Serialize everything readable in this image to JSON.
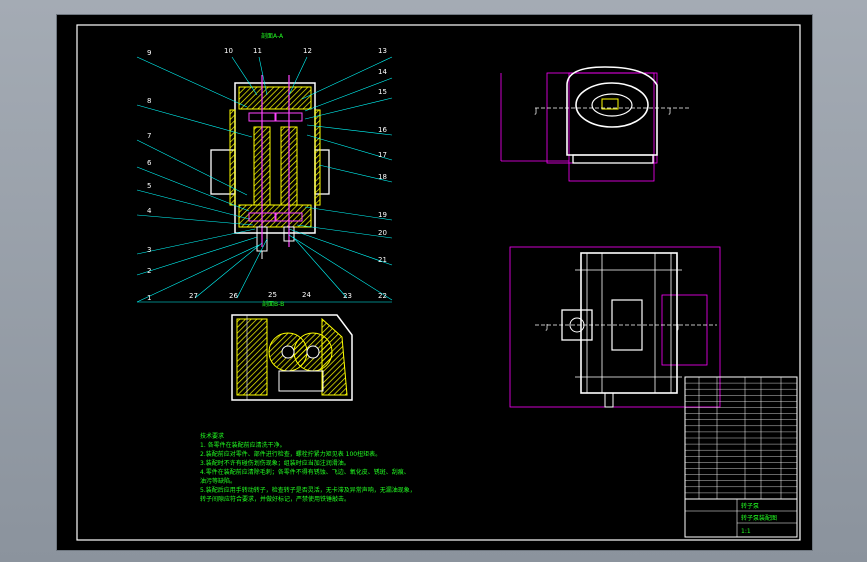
{
  "part_labels_left": [
    "9",
    "8",
    "7",
    "6",
    "5",
    "4",
    "3",
    "2",
    "1"
  ],
  "part_labels_top": [
    "10",
    "11",
    "12",
    "13"
  ],
  "part_labels_right": [
    "14",
    "15",
    "16",
    "17",
    "18",
    "19",
    "20",
    "21",
    "22"
  ],
  "part_labels_bottom": [
    "27",
    "26",
    "23"
  ],
  "section_labels": {
    "aa": "剖面A-A",
    "bb": "剖面B-B",
    "bb_right": "24",
    "bb_left": "25"
  },
  "view_marks": {
    "left": "J",
    "right": "J",
    "left2": "J",
    "right2": "J"
  },
  "notes": {
    "title": "技术要求",
    "lines": [
      "1. 各零件在装配前应清洗干净。",
      "2.装配前应对零件、部件进行检查，螺栓拧紧力矩见表 100扭矩表。",
      "3.装配时不许有碰伤划伤现象；组装时应当加注润滑油。",
      "4.零件在装配前应清除毛刺；各零件不得有锈蚀、飞边、氧化皮、锈斑、刮痕、",
      "  油污等缺陷。",
      "5.装配后应用手转动转子，检查转子是否灵活，无卡滞及异常声响，无漏油现象，",
      "  转子间隙应符合要求，并做好标记，严禁使用铁锤敲击。"
    ]
  },
  "title_block": {
    "name": "转子泵",
    "scale": "1:1",
    "drawing_no": "转子泵装配图"
  },
  "colors": {
    "hatch": "#ffff00",
    "outline": "#ffffff",
    "leader": "#00ffff",
    "dim": "#ff00ff",
    "text": "#22ff22",
    "part": "#ff44ff"
  }
}
